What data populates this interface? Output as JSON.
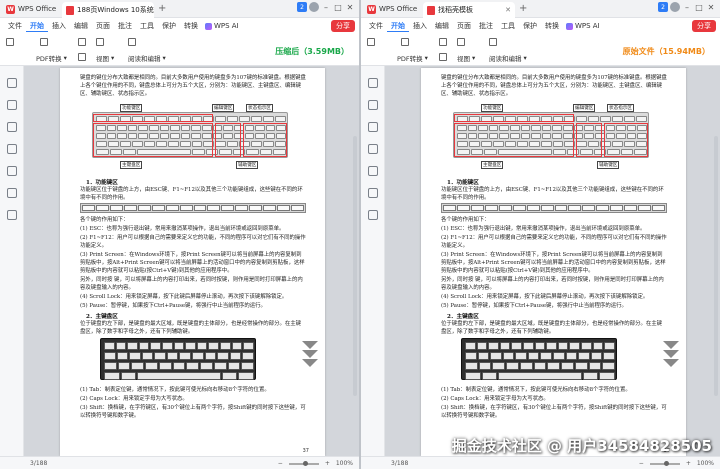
{
  "panes": [
    {
      "app_name": "WPS Office",
      "doc_tab": "188页Windows 10系统使用",
      "notify_count": "2",
      "menu": [
        "文件",
        "开始",
        "插入",
        "编辑",
        "页面",
        "批注",
        "工具",
        "保护",
        "转换"
      ],
      "menu_active": "开始",
      "ai_label": "WPS AI",
      "share_label": "分享",
      "tools": {
        "pdf_convert": "PDF转换",
        "view": "视图",
        "read_edit": "阅读和编辑"
      },
      "size_label": "压缩后（3.59MB）",
      "size_color": "#1aa84a",
      "status_page": "3/188",
      "zoom": "100%"
    },
    {
      "app_name": "WPS Office",
      "doc_tab": "找稻壳模板",
      "notify_count": "2",
      "menu": [
        "文件",
        "开始",
        "插入",
        "编辑",
        "页面",
        "批注",
        "工具",
        "保护",
        "转换"
      ],
      "menu_active": "开始",
      "ai_label": "WPS AI",
      "share_label": "分享",
      "tools": {
        "pdf_convert": "PDF转换",
        "view": "视图",
        "read_edit": "阅读和编辑"
      },
      "size_label": "原始文件（15.94MB）",
      "size_color": "#f08a17",
      "status_page": "3/188",
      "zoom": "100%"
    }
  ],
  "document": {
    "intro": "键盘的键位分布大致都是相同的。目前大多数用户使用的键盘多为107键的标准键盘。根据键盘上各个键位作用的不同，键盘总体上可分为五个大区，分别为：功能键区、主键盘区、编辑键区、辅助键区、状态指示区。",
    "callouts": {
      "function_keys": "功能键区",
      "edit_keys": "编辑键区",
      "status_indicator": "状态指示区",
      "main_keys": "主键盘区",
      "aux_keys": "辅助键区"
    },
    "h1": "1．功能键区",
    "p1": "功能键区位于键盘的上方，由ESC键、F1~F12以及其他三个功能键组成，这些键在不同的环境中有不同的作用。",
    "p2": "各个键的作用如下：",
    "p3": "(1) ESC：也称为强行退出键，常用来撤消某项操作，退出当前环境或返回到原菜单。",
    "p4": "(2) F1~F12：用户可以根据自己的需要来定义它的功能，不同的程序可以对它们有不同的操作功能定义。",
    "p5": "(3) Print Screen：在Windows环境下，按Print Screen键可以将当前屏幕上的内容复制到剪贴板中，按Alt+Print Screen键可以将当前屏幕上的活动窗口中的内容复制到剪贴板，这样剪贴板中的内容就可以粘贴(按Ctrl+V键)到其他的应用程序中。",
    "p6": "另外，同时按                    键，可以将屏幕上的内容打印出来，若同时按键，则作用是同时打印屏幕上的内容及键盘输入的内容。",
    "p7": "(4) Scroll Lock：用来锁定屏幕，按下此键后屏幕停止滚动，再次按下该键解除锁定。",
    "p8": "(5) Pause：暂停键，如果按下Ctrl+Pause键，将强行中止当前程序的运行。",
    "h2": "2．主键盘区",
    "p9": "位于键盘的左下部，是键盘的最大区域，既是键盘的主体部分，也是经常操作的部分。在主键盘区，除了数字和字母之外，还有下列辅助键。",
    "p10": "(1) Tab：制表定位键，通常情况下，按此键可使光标向右移动8个字符的位置。",
    "p11": "(2) Caps Lock：用来锁定字母为大写状态。",
    "p12": "(3) Shift：换档键，在字符键区，有30个键位上有两个字符，按Shift键的同时按下这些键，可以转换符号键和数字键。",
    "page_no": "37"
  },
  "watermark": "掘金技术社区 @ 用户34584828505"
}
